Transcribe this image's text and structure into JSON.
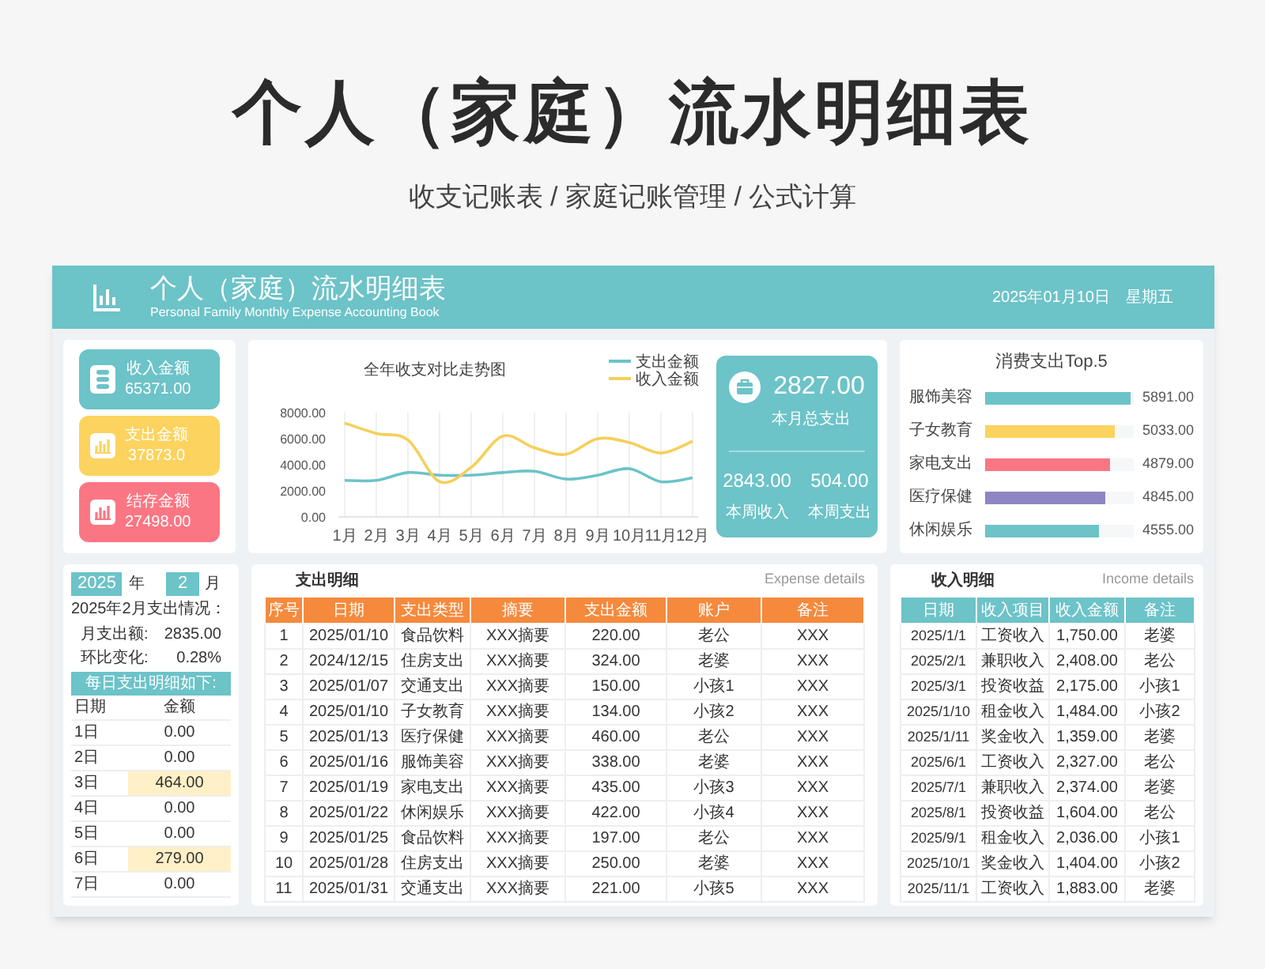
{
  "page_title": "个人（家庭）流水明细表",
  "page_subtitle": "收支记账表 / 家庭记账管理 / 公式计算",
  "dashboard": {
    "title": "个人（家庭）流水明细表",
    "subtitle_en": "Personal Family Monthly Expense Accounting Book",
    "date": "2025年01月10日",
    "weekday": "星期五"
  },
  "stat_cards": [
    {
      "kind": "stack",
      "label": "收入金额",
      "value": "65371.00",
      "color": "#6cc3c8"
    },
    {
      "kind": "chart",
      "label": "支出金额",
      "value": "37873.0",
      "color": "#fcd35e"
    },
    {
      "kind": "chart",
      "label": "结存金额",
      "value": "27498.00",
      "color": "#fb7683"
    }
  ],
  "trend": {
    "chart_data": {
      "type": "line",
      "title": "全年收支对比走势图",
      "categories": [
        "1月",
        "2月",
        "3月",
        "4月",
        "5月",
        "6月",
        "7月",
        "8月",
        "9月",
        "10月",
        "11月",
        "12月"
      ],
      "series": [
        {
          "name": "支出金额",
          "color": "#6cc3c8",
          "values": [
            2800,
            2800,
            3400,
            3200,
            3200,
            3400,
            3500,
            2900,
            3200,
            3700,
            2700,
            3000
          ]
        },
        {
          "name": "收入金额",
          "color": "#f6cf5a",
          "values": [
            7200,
            6400,
            5900,
            2700,
            3800,
            6200,
            5300,
            4800,
            6000,
            5700,
            4900,
            5800
          ]
        }
      ],
      "ylim": [
        0,
        8000
      ],
      "grid": true,
      "legend": true,
      "yticks": [
        {
          "value": 0,
          "label": "0.00"
        },
        {
          "value": 2000,
          "label": "2000.00"
        },
        {
          "value": 4000,
          "label": "4000.00"
        },
        {
          "value": 6000,
          "label": "6000.00"
        },
        {
          "value": 8000,
          "label": "8000.00"
        }
      ]
    }
  },
  "summary": {
    "value": "2827.00",
    "label": "本月总支出",
    "items": [
      {
        "value": "2843.00",
        "label": "本周收入"
      },
      {
        "value": "504.00",
        "label": "本周支出"
      }
    ]
  },
  "top5": {
    "title": "消费支出Top.5",
    "items": [
      {
        "label": "服饰美容",
        "value": "5891.00",
        "level": 0.98,
        "color": "#6cc3c8"
      },
      {
        "label": "子女教育",
        "value": "5033.00",
        "level": 0.87,
        "color": "#fcd35e"
      },
      {
        "label": "家电支出",
        "value": "4879.00",
        "level": 0.84,
        "color": "#fb7683"
      },
      {
        "label": "医疗保健",
        "value": "4845.00",
        "level": 0.81,
        "color": "#8e86c4"
      },
      {
        "label": "休闲娱乐",
        "value": "4555.00",
        "level": 0.77,
        "color": "#6cc3c8"
      }
    ]
  },
  "monthly": {
    "year": "2025",
    "year_unit": "年",
    "month": "2",
    "month_unit": "月",
    "heading": "2025年2月支出情况：",
    "stats": [
      {
        "label": "月支出额:",
        "value": "2835.00"
      },
      {
        "label": "环比变化:",
        "value": "0.28%"
      }
    ],
    "daily_heading": "每日支出明细如下:",
    "columns": [
      "日期",
      "金额"
    ],
    "rows": [
      {
        "day": "1日",
        "amount": "0.00",
        "highlighted": false
      },
      {
        "day": "2日",
        "amount": "0.00",
        "highlighted": false
      },
      {
        "day": "3日",
        "amount": "464.00",
        "highlighted": true
      },
      {
        "day": "4日",
        "amount": "0.00",
        "highlighted": false
      },
      {
        "day": "5日",
        "amount": "0.00",
        "highlighted": false
      },
      {
        "day": "6日",
        "amount": "279.00",
        "highlighted": true
      },
      {
        "day": "7日",
        "amount": "0.00",
        "highlighted": false
      }
    ]
  },
  "expense": {
    "title": "支出明细",
    "title_en": "Expense details",
    "columns": [
      "序号",
      "日期",
      "支出类型",
      "摘要",
      "支出金额",
      "账户",
      "备注"
    ],
    "rows": [
      [
        "1",
        "2025/01/10",
        "食品饮料",
        "XXX摘要",
        "220.00",
        "老公",
        "XXX"
      ],
      [
        "2",
        "2024/12/15",
        "住房支出",
        "XXX摘要",
        "324.00",
        "老婆",
        "XXX"
      ],
      [
        "3",
        "2025/01/07",
        "交通支出",
        "XXX摘要",
        "150.00",
        "小孩1",
        "XXX"
      ],
      [
        "4",
        "2025/01/10",
        "子女教育",
        "XXX摘要",
        "134.00",
        "小孩2",
        "XXX"
      ],
      [
        "5",
        "2025/01/13",
        "医疗保健",
        "XXX摘要",
        "460.00",
        "老公",
        "XXX"
      ],
      [
        "6",
        "2025/01/16",
        "服饰美容",
        "XXX摘要",
        "338.00",
        "老婆",
        "XXX"
      ],
      [
        "7",
        "2025/01/19",
        "家电支出",
        "XXX摘要",
        "435.00",
        "小孩3",
        "XXX"
      ],
      [
        "8",
        "2025/01/22",
        "休闲娱乐",
        "XXX摘要",
        "422.00",
        "小孩4",
        "XXX"
      ],
      [
        "9",
        "2025/01/25",
        "食品饮料",
        "XXX摘要",
        "197.00",
        "老公",
        "XXX"
      ],
      [
        "10",
        "2025/01/28",
        "住房支出",
        "XXX摘要",
        "250.00",
        "老婆",
        "XXX"
      ],
      [
        "11",
        "2025/01/31",
        "交通支出",
        "XXX摘要",
        "221.00",
        "小孩5",
        "XXX"
      ]
    ]
  },
  "income": {
    "title": "收入明细",
    "title_en": "Income details",
    "columns": [
      "日期",
      "收入项目",
      "收入金额",
      "备注"
    ],
    "rows": [
      [
        "2025/1/1",
        "工资收入",
        "1,750.00",
        "老婆"
      ],
      [
        "2025/2/1",
        "兼职收入",
        "2,408.00",
        "老公"
      ],
      [
        "2025/3/1",
        "投资收益",
        "2,175.00",
        "小孩1"
      ],
      [
        "2025/1/10",
        "租金收入",
        "1,484.00",
        "小孩2"
      ],
      [
        "2025/1/11",
        "奖金收入",
        "1,359.00",
        "老婆"
      ],
      [
        "2025/6/1",
        "工资收入",
        "2,327.00",
        "老公"
      ],
      [
        "2025/7/1",
        "兼职收入",
        "2,374.00",
        "老婆"
      ],
      [
        "2025/8/1",
        "投资收益",
        "1,604.00",
        "老公"
      ],
      [
        "2025/9/1",
        "租金收入",
        "2,036.00",
        "小孩1"
      ],
      [
        "2025/10/1",
        "奖金收入",
        "1,404.00",
        "小孩2"
      ],
      [
        "2025/11/1",
        "工资收入",
        "1,883.00",
        "老婆"
      ]
    ]
  }
}
